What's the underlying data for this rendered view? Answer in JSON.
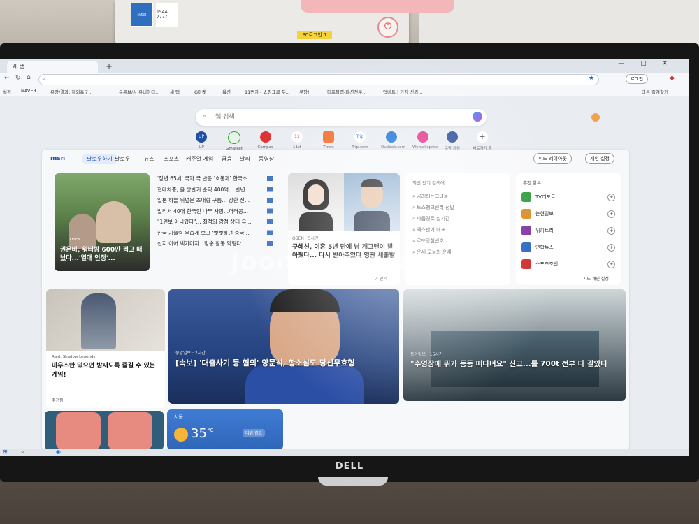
{
  "desk": {
    "pc_sticker_label": "PC로그인 1",
    "sticker_intel": "intel",
    "sticker_support": "1544-7777",
    "monitor_brand": "DELL"
  },
  "browser": {
    "tab_title": "새 탭",
    "bookmarks": [
      "설정",
      "NAVER",
      "유장/결과: 해외축구...",
      "유튜브/사 유니아티...",
      "새 탭",
      "G마켓",
      "옥션",
      "11번가 - 쇼핑표로 두...",
      "쿠팡!",
      "티프블랩-파션전문...",
      "업비트 | 가장 신뢰..."
    ],
    "other_bookmarks": "다른 즐겨찾기",
    "profile_label": "로그인",
    "search_placeholder": "웹 검색",
    "quick_links": [
      "UP",
      "Gmarket",
      "Compaq",
      "11st",
      "Tmon",
      "Trip.com",
      "Outlook.com",
      "Wemakeprice",
      "쿠팡 게임",
      "바로가기 추가"
    ]
  },
  "msn": {
    "logo": "msn",
    "nav": [
      "팔로우하기",
      "팔로우",
      "뉴스",
      "스포츠",
      "캐주얼 게임",
      "금융",
      "날씨",
      "동영상"
    ],
    "feed_layout_button": "피드 레이아웃",
    "personalize_button": "개인 설정",
    "lead_story": "권은비, 워터밤 600만 찍고 떠났다...'열애 인정'...",
    "lead_source": "OSEN",
    "headlines": [
      "'정년 65세' 극과 극 반응 '호봉제' 한국소...",
      "현대차증, 올 상반기 순익 400억... 반년...",
      "일본 하늘 뒤덮은 초대형 구름... 강한 신...",
      "빌리서 40대 한국인 나무 사망...퍼러공...",
      "\"1면보 아니었다\"... 최적의 강점 상태 유...",
      "한국 기술력 우습게 보고 '뻿뻿하던 중국...",
      "신지 이어 백가마지...방송 활동 악형다..."
    ],
    "center_story": {
      "source": "OSEN · 5시간",
      "title": "구혜선, 이혼 5년 만에 남 개그맨이 받아줬다... 다시 받아주었다 영광 새출발",
      "footer": "↗ 인기"
    },
    "trending": {
      "title": "최신 인기 검색어",
      "items": [
        "곰래리는그녀들",
        "토스뱅크런리 정말",
        "파룸경로 실시간",
        "엑스판기 대표",
        "로또당첨번호",
        "운세 오늘의 운세"
      ]
    },
    "recommended": {
      "title": "추천 항목",
      "items": [
        "TV리포트",
        "논현일보",
        "위키트리",
        "연합뉴스",
        "스포츠조선"
      ],
      "logo_colors": [
        "#2a9a3a",
        "#d98a20",
        "#7a2aa0",
        "#1f5fbf",
        "#c22"
      ],
      "footer": "피드 개인 설정"
    },
    "game_card": {
      "source": "Raid: Shadow Legends",
      "title": "마우스만 있으면 밤새도록 즐길 수 있는 게임!",
      "footer": "추천됨"
    },
    "breaking_card": {
      "source": "중앙일보 · 2시간",
      "title": "[속보] '대출사기 등 혐의' 양문석, 항소심도 당선무효형"
    },
    "pool_card": {
      "source": "동아일보 · 15시간",
      "title": "\"수영장에 뭐가 둥둥 떠다녀요\" 신고...를 700t 전부 다 갈았다"
    },
    "weather": {
      "city": "서울",
      "temperature": "35",
      "unit": "°C",
      "alert": "더위 경고"
    }
  },
  "watermark": "Joonggonara"
}
